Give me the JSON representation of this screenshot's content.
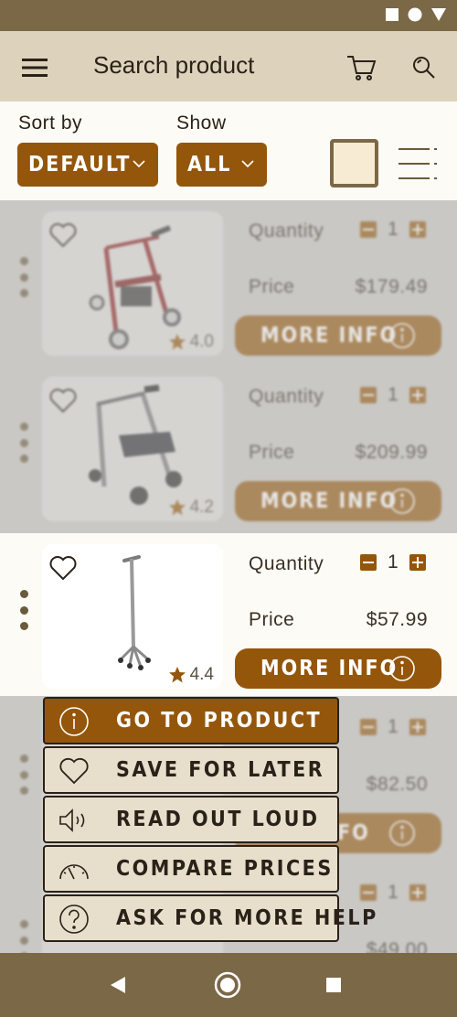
{
  "app": {
    "title": "Search product",
    "accent_color": "#94560b",
    "bar_color": "#7a6847",
    "header_color": "#ddd3bc"
  },
  "toolbar": {
    "menu_icon": "hamburger-menu-icon",
    "cart_icon": "cart-icon",
    "search_icon": "search-icon"
  },
  "filters": {
    "sort_label": "Sort by",
    "sort_value": "DEFAULT",
    "show_label": "Show",
    "show_value": "ALL",
    "view_grid_icon": "grid-view-icon",
    "view_list_icon": "list-view-icon"
  },
  "products": [
    {
      "name": "red rollator walker",
      "quantity_label": "Quantity",
      "quantity": "1",
      "price_label": "Price",
      "price": "$179.49",
      "rating": "4.0",
      "more_label": "MORE INFO",
      "dimmed": true
    },
    {
      "name": "grey rollator walker",
      "quantity_label": "Quantity",
      "quantity": "1",
      "price_label": "Price",
      "price": "$209.99",
      "rating": "4.2",
      "more_label": "MORE INFO",
      "dimmed": true
    },
    {
      "name": "quad cane",
      "quantity_label": "Quantity",
      "quantity": "1",
      "price_label": "Price",
      "price": "$57.99",
      "rating": "4.4",
      "more_label": "MORE INFO",
      "dimmed": false
    },
    {
      "name": "",
      "quantity_label": "",
      "quantity": "1",
      "price_label": "",
      "price": "$82.50",
      "rating": "",
      "more_label": "FO",
      "dimmed": true
    },
    {
      "name": "",
      "quantity_label": "",
      "quantity": "1",
      "price_label": "",
      "price": "$49.00",
      "rating": "",
      "more_label": "",
      "dimmed": true
    }
  ],
  "context_menu": {
    "items": [
      {
        "label": "GO TO PRODUCT",
        "icon": "info-icon",
        "active": true
      },
      {
        "label": "SAVE FOR LATER",
        "icon": "heart-icon",
        "active": false
      },
      {
        "label": "READ OUT LOUD",
        "icon": "speaker-icon",
        "active": false
      },
      {
        "label": "COMPARE PRICES",
        "icon": "gauge-icon",
        "active": false
      },
      {
        "label": "ASK FOR MORE HELP",
        "icon": "help-icon",
        "active": false
      }
    ]
  },
  "navbar": {
    "back_icon": "back-triangle-icon",
    "home_icon": "home-circle-icon",
    "recents_icon": "recents-square-icon"
  }
}
